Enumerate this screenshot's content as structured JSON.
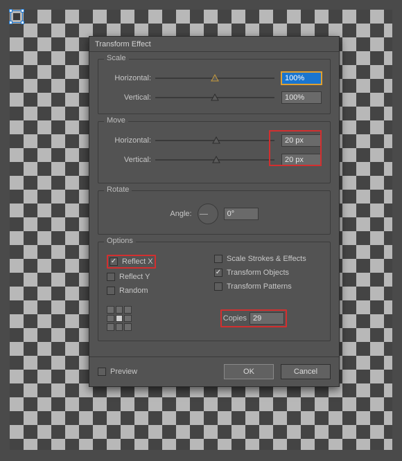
{
  "dialog": {
    "title": "Transform Effect",
    "scale": {
      "title": "Scale",
      "h_label": "Horizontal:",
      "v_label": "Vertical:",
      "h_value": "100%",
      "v_value": "100%"
    },
    "move": {
      "title": "Move",
      "h_label": "Horizontal:",
      "v_label": "Vertical:",
      "h_value": "20 px",
      "v_value": "20 px"
    },
    "rotate": {
      "title": "Rotate",
      "angle_label": "Angle:",
      "angle_value": "0°"
    },
    "options": {
      "title": "Options",
      "reflect_x": "Reflect X",
      "reflect_y": "Reflect Y",
      "random": "Random",
      "scale_strokes": "Scale Strokes & Effects",
      "transform_objects": "Transform Objects",
      "transform_patterns": "Transform Patterns",
      "copies_label": "Copies",
      "copies_value": "29"
    },
    "footer": {
      "preview": "Preview",
      "ok": "OK",
      "cancel": "Cancel"
    }
  }
}
